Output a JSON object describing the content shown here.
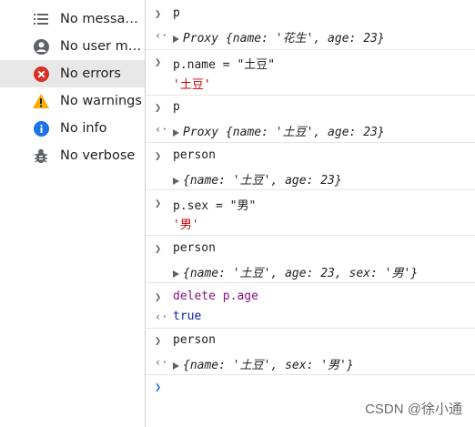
{
  "sidebar": {
    "items": [
      {
        "label": "No messages",
        "icon": "list-icon"
      },
      {
        "label": "No user me…",
        "icon": "user-icon"
      },
      {
        "label": "No errors",
        "icon": "error-icon"
      },
      {
        "label": "No warnings",
        "icon": "warning-icon"
      },
      {
        "label": "No info",
        "icon": "info-icon"
      },
      {
        "label": "No verbose",
        "icon": "bug-icon"
      }
    ],
    "selected_index": 2
  },
  "console": {
    "entries": [
      {
        "input": "p",
        "output_prefix": "Proxy ",
        "output": "{name: '花生', age: 23}"
      },
      {
        "input": "p.name = \"土豆\"",
        "output": "'土豆'"
      },
      {
        "input": "p",
        "output_prefix": "Proxy ",
        "output": "{name: '土豆', age: 23}"
      },
      {
        "input": "person",
        "output": "{name: '土豆', age: 23}"
      },
      {
        "input": "p.sex = \"男\"",
        "output": "'男'"
      },
      {
        "input": "person",
        "output": "{name: '土豆', age: 23, sex: '男'}"
      },
      {
        "input": "delete p.age",
        "output": "true"
      },
      {
        "input": "person",
        "output": "{name: '土豆', sex: '男'}"
      }
    ]
  },
  "watermark": "CSDN @徐小通",
  "colors": {
    "error": "#d93025",
    "warning": "#f9ab00",
    "info": "#1a73e8",
    "prompt_arrow": "#1a73e8"
  }
}
